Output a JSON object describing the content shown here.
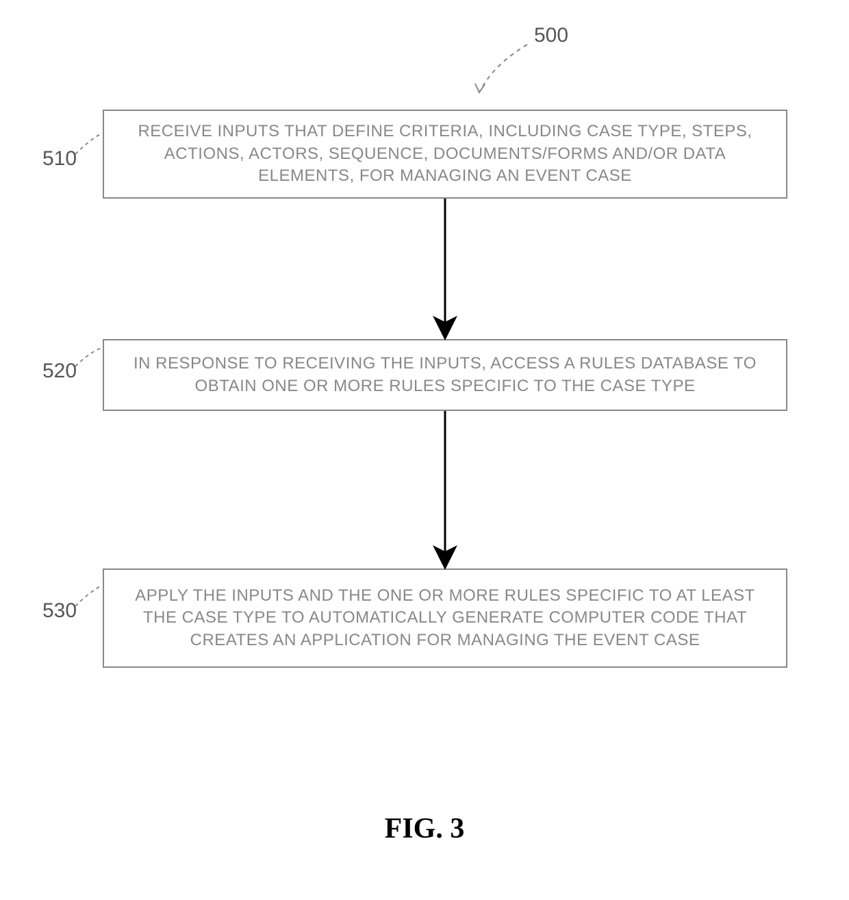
{
  "figure": {
    "title": "FIG. 3",
    "ref_main": "500"
  },
  "steps": [
    {
      "ref": "510",
      "text": "RECEIVE INPUTS THAT DEFINE CRITERIA, INCLUDING CASE TYPE, STEPS, ACTIONS, ACTORS, SEQUENCE, DOCUMENTS/FORMS AND/OR DATA ELEMENTS, FOR MANAGING AN EVENT CASE"
    },
    {
      "ref": "520",
      "text": "IN RESPONSE TO RECEIVING THE INPUTS, ACCESS A RULES DATABASE TO OBTAIN ONE OR MORE RULES SPECIFIC TO THE CASE TYPE"
    },
    {
      "ref": "530",
      "text": "APPLY THE INPUTS AND THE ONE OR MORE RULES SPECIFIC TO AT LEAST THE CASE TYPE TO AUTOMATICALLY GENERATE COMPUTER CODE THAT CREATES AN APPLICATION FOR MANAGING THE EVENT CASE"
    }
  ]
}
